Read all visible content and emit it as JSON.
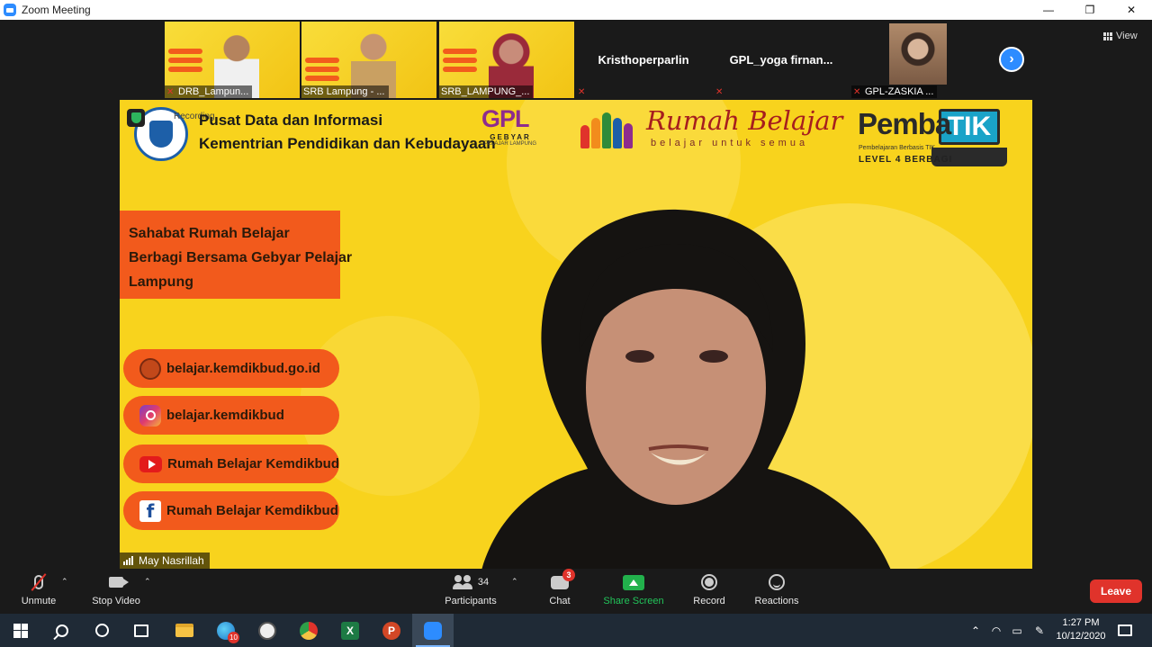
{
  "window": {
    "title": "Zoom Meeting",
    "controls": [
      "—",
      "❐",
      "✕"
    ]
  },
  "strip": {
    "tiles": [
      {
        "name": "DRB_Lampun...",
        "muted": true,
        "type": "video"
      },
      {
        "name": "SRB Lampung - ...",
        "muted": false,
        "type": "video"
      },
      {
        "name": "SRB_LAMPUNG_...",
        "muted": false,
        "type": "video"
      },
      {
        "name": "Kristhoperparlin",
        "muted": true,
        "type": "name"
      },
      {
        "name": "GPL_yoga  firnan...",
        "muted": true,
        "type": "name"
      },
      {
        "name": "GPL-ZASKIA ...",
        "muted": true,
        "type": "video"
      }
    ],
    "view_label": "View"
  },
  "slide": {
    "recording_label": "Recording",
    "header_line1": "Pusat Data dan Informasi",
    "header_line2": "Kementrian Pendidikan dan Kebudayaan",
    "gpl_logo": "GPL",
    "gpl_sub": "GEBYAR",
    "gpl_sub2": "PELAJAR LAMPUNG",
    "rb_title": "Rumah Belajar",
    "rb_tagline": "belajar untuk semua",
    "pemba": "Pemba",
    "tik": "TIK",
    "pemb_sub1": "Pembelajaran Berbasis TIK",
    "pemb_sub2": "LEVEL 4 BERBAGI",
    "orange_lines": [
      "Sahabat Rumah Belajar",
      "Berbagi Bersama Gebyar Pelajar",
      "Lampung"
    ],
    "pills": [
      {
        "icon": "globe-icon",
        "text": "belajar.kemdikbud.go.id"
      },
      {
        "icon": "instagram-icon",
        "text": "belajar.kemdikbud"
      },
      {
        "icon": "youtube-icon",
        "text": "Rumah Belajar Kemdikbud"
      },
      {
        "icon": "facebook-icon",
        "text": "Rumah Belajar Kemdikbud"
      }
    ],
    "speaker_name": "May Nasrillah"
  },
  "toolbar": {
    "unmute": "Unmute",
    "stop_video": "Stop Video",
    "participants": "Participants",
    "participants_count": "34",
    "chat": "Chat",
    "chat_badge": "3",
    "share_screen": "Share Screen",
    "record": "Record",
    "reactions": "Reactions",
    "leave": "Leave"
  },
  "taskbar": {
    "edge_badge": "10",
    "excel_letter": "X",
    "ppt_letter": "P",
    "time": "1:27 PM",
    "date": "10/12/2020"
  },
  "colors": {
    "zoom_blue": "#2d8cff",
    "slide_yellow": "#f8d31d",
    "slide_orange": "#f25a1c",
    "leave_red": "#e0332b",
    "share_green": "#22b14c"
  }
}
